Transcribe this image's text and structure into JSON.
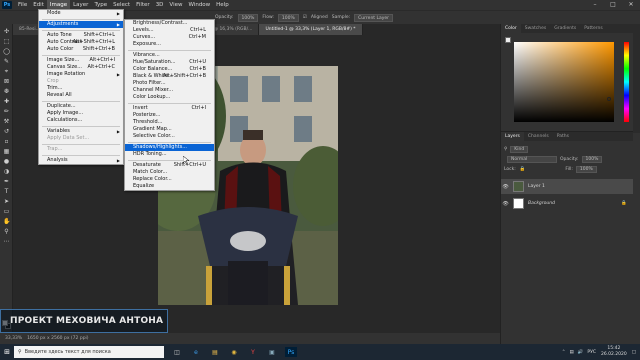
{
  "menubar": {
    "app_icon": "Ps",
    "items": [
      "File",
      "Edit",
      "Image",
      "Layer",
      "Type",
      "Select",
      "Filter",
      "3D",
      "View",
      "Window",
      "Help"
    ],
    "active_item": "Image"
  },
  "optbar": {
    "opacity_label": "Opacity:",
    "opacity_value": "100%",
    "flow_label": "Flow:",
    "flow_value": "100%",
    "aligned_label": "Aligned",
    "sample_label": "Sample:",
    "sample_value": "Current Layer"
  },
  "tabs": [
    {
      "label": "85-Resi...",
      "active": false
    },
    {
      "label": "... 00ky_9, RGB/8#) *",
      "active": false
    },
    {
      "label": "IMG_4298-Recovered.CR2 @ 16,3% (RGB/...",
      "active": false
    },
    {
      "label": "Untitled-1 @ 33,3% (Layer 1, RGB/8#) *",
      "active": true
    }
  ],
  "image_menu": [
    {
      "label": "Mode",
      "arrow": true
    },
    {
      "sep": true
    },
    {
      "label": "Adjustments",
      "arrow": true,
      "highlight": true
    },
    {
      "sep": true
    },
    {
      "label": "Auto Tone",
      "shortcut": "Shift+Ctrl+L"
    },
    {
      "label": "Auto Contrast",
      "shortcut": "Alt+Shift+Ctrl+L"
    },
    {
      "label": "Auto Color",
      "shortcut": "Shift+Ctrl+B"
    },
    {
      "sep": true
    },
    {
      "label": "Image Size...",
      "shortcut": "Alt+Ctrl+I"
    },
    {
      "label": "Canvas Size...",
      "shortcut": "Alt+Ctrl+C"
    },
    {
      "label": "Image Rotation",
      "arrow": true
    },
    {
      "label": "Crop",
      "disabled": true
    },
    {
      "label": "Trim..."
    },
    {
      "label": "Reveal All"
    },
    {
      "sep": true
    },
    {
      "label": "Duplicate..."
    },
    {
      "label": "Apply Image..."
    },
    {
      "label": "Calculations..."
    },
    {
      "sep": true
    },
    {
      "label": "Variables",
      "arrow": true
    },
    {
      "label": "Apply Data Set...",
      "disabled": true
    },
    {
      "sep": true
    },
    {
      "label": "Trap...",
      "disabled": true
    },
    {
      "sep": true
    },
    {
      "label": "Analysis",
      "arrow": true
    }
  ],
  "adjustments_menu": [
    {
      "label": "Brightness/Contrast..."
    },
    {
      "label": "Levels...",
      "shortcut": "Ctrl+L"
    },
    {
      "label": "Curves...",
      "shortcut": "Ctrl+M"
    },
    {
      "label": "Exposure..."
    },
    {
      "sep": true
    },
    {
      "label": "Vibrance..."
    },
    {
      "label": "Hue/Saturation...",
      "shortcut": "Ctrl+U"
    },
    {
      "label": "Color Balance...",
      "shortcut": "Ctrl+B"
    },
    {
      "label": "Black & White...",
      "shortcut": "Alt+Shift+Ctrl+B"
    },
    {
      "label": "Photo Filter..."
    },
    {
      "label": "Channel Mixer..."
    },
    {
      "label": "Color Lookup..."
    },
    {
      "sep": true
    },
    {
      "label": "Invert",
      "shortcut": "Ctrl+I"
    },
    {
      "label": "Posterize..."
    },
    {
      "label": "Threshold..."
    },
    {
      "label": "Gradient Map..."
    },
    {
      "label": "Selective Color..."
    },
    {
      "sep": true
    },
    {
      "label": "Shadows/Highlights...",
      "highlight": true
    },
    {
      "label": "HDR Toning..."
    },
    {
      "sep": true
    },
    {
      "label": "Desaturate",
      "shortcut": "Shift+Ctrl+U"
    },
    {
      "label": "Match Color..."
    },
    {
      "label": "Replace Color..."
    },
    {
      "label": "Equalize"
    }
  ],
  "statusbar": {
    "zoom": "33,33%",
    "doc_info": "1650 px x 2560 px (72 ppi)"
  },
  "watermark": "ПРОЕКТ МЕХОВИЧА АНТОНА",
  "right_panel": {
    "color_tabs": [
      "Color",
      "Swatches",
      "Gradients",
      "Patterns"
    ],
    "layers_tabs": [
      "Layers",
      "Channels",
      "Paths"
    ],
    "kind_label": "Kind",
    "blend_mode": "Normal",
    "opacity_label": "Opacity:",
    "opacity_value": "100%",
    "lock_label": "Lock:",
    "fill_label": "Fill:",
    "fill_value": "100%",
    "layers": [
      {
        "name": "Layer 1",
        "selected": true,
        "italic": false
      },
      {
        "name": "Background",
        "selected": false,
        "italic": true
      }
    ]
  },
  "taskbar": {
    "search_placeholder": "Введите здесь текст для поиска",
    "language": "РУС",
    "time": "15:42",
    "date": "26.02.2020"
  },
  "colors": {
    "highlight": "#0a64d4",
    "menu_bg": "#f0f0f0",
    "ui_dark": "#323232",
    "watermark_border": "#3e6fa0"
  }
}
